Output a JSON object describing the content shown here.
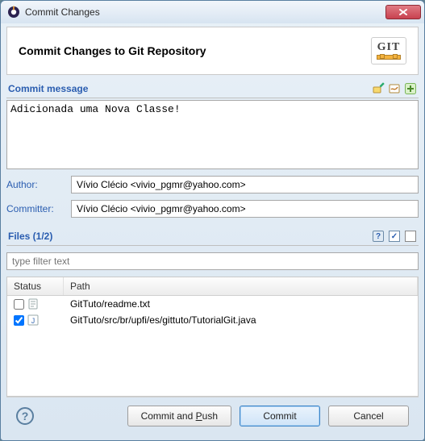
{
  "window": {
    "title": "Commit Changes"
  },
  "header": {
    "title": "Commit Changes to Git Repository",
    "badge": "GIT"
  },
  "commit": {
    "section_label": "Commit message",
    "message": "Adicionada uma Nova Classe!",
    "author_label": "Author:",
    "author_value": "Vívio Clécio <vivio_pgmr@yahoo.com>",
    "committer_label": "Committer:",
    "committer_value": "Vívio Clécio <vivio_pgmr@yahoo.com>"
  },
  "files": {
    "section_label": "Files (1/2)",
    "filter_placeholder": "type filter text",
    "columns": {
      "status": "Status",
      "path": "Path"
    },
    "rows": [
      {
        "checked": false,
        "icon": "text-file-icon",
        "path": "GitTuto/readme.txt"
      },
      {
        "checked": true,
        "icon": "java-file-icon",
        "path": "GitTuto/src/br/upfi/es/gittuto/TutorialGit.java"
      }
    ]
  },
  "buttons": {
    "commit_and_push": "Commit and Push",
    "commit": "Commit",
    "cancel": "Cancel"
  },
  "icons": {
    "bulk_select": "select-all",
    "bulk_deselect": "deselect-all",
    "help": "?",
    "amend": "amend",
    "signoff": "signoff",
    "showdiff": "showdiff"
  }
}
